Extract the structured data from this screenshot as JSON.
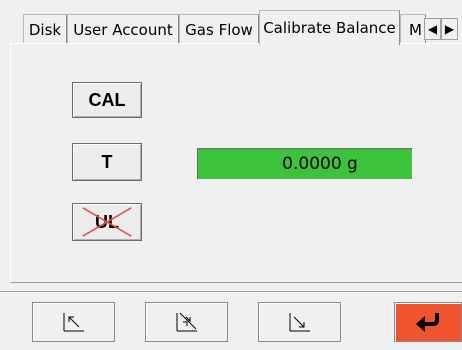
{
  "tabs": [
    {
      "label": "Disk"
    },
    {
      "label": "User Account"
    },
    {
      "label": "Gas Flow"
    },
    {
      "label": "Calibrate Balance",
      "active": true
    },
    {
      "label": "M"
    }
  ],
  "tab_scroll": {
    "left_icon": "arrow-left-icon",
    "right_icon": "arrow-right-icon",
    "left_glyph": "◀",
    "right_glyph": "▶"
  },
  "panel": {
    "cal_label": "CAL",
    "tare_label": "T",
    "unload_label": "UL",
    "unload_disabled": true,
    "weight_readout": "0.0000 g",
    "readout_color": "#3dc23b"
  },
  "toolbar": {
    "buttons": [
      {
        "icon": "move-up-left-icon"
      },
      {
        "icon": "move-center-icon"
      },
      {
        "icon": "move-down-right-icon"
      },
      {
        "icon": "enter-return-icon",
        "color": "#f0542e"
      }
    ]
  }
}
